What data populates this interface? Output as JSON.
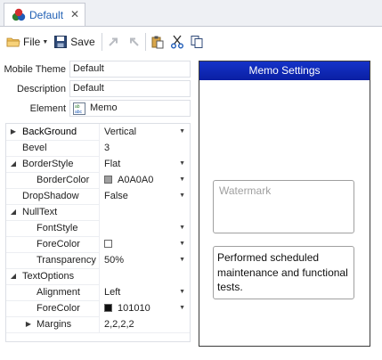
{
  "tab": {
    "label": "Default",
    "close_glyph": "✕",
    "icon": "theme-icon"
  },
  "toolbar": {
    "file_label": "File",
    "save_label": "Save",
    "icons": [
      "file-icon",
      "save-icon",
      "redo-icon",
      "undo-icon",
      "paste-icon",
      "cut-icon",
      "copy-icon"
    ]
  },
  "fields": [
    {
      "label": "Mobile Theme",
      "value": "Default"
    },
    {
      "label": "Description",
      "value": "Default"
    },
    {
      "label": "Element",
      "value": "Memo",
      "icon_text": "ab abc"
    }
  ],
  "properties": [
    {
      "name": "BackGround",
      "value": "Vertical",
      "expander": "▶",
      "dropdown": true,
      "selected": true
    },
    {
      "name": "Bevel",
      "value": "3"
    },
    {
      "name": "BorderStyle",
      "value": "Flat",
      "expander": "◢",
      "dropdown": true
    },
    {
      "name": "BorderColor",
      "value": "A0A0A0",
      "swatch": "#a0a0a0",
      "dropdown": true
    },
    {
      "name": "DropShadow",
      "value": "False",
      "dropdown": true
    },
    {
      "name": "NullText",
      "value": "",
      "expander": "◢"
    },
    {
      "name": "FontStyle",
      "value": "",
      "dropdown": true
    },
    {
      "name": "ForeColor",
      "value": "",
      "swatch": "#ffffff",
      "dropdown": true
    },
    {
      "name": "Transparency",
      "value": "50%",
      "dropdown": true
    },
    {
      "name": "TextOptions",
      "value": "",
      "expander": "◢"
    },
    {
      "name": "Alignment",
      "value": "Left",
      "dropdown": true
    },
    {
      "name": "ForeColor",
      "value": "101010",
      "swatch": "#101010",
      "dropdown": true
    },
    {
      "name": "Margins",
      "value": "2,2,2,2",
      "expander": "▶"
    }
  ],
  "preview": {
    "title": "Memo Settings",
    "watermark": "Watermark",
    "memo_text": "Performed scheduled maintenance and functional tests."
  },
  "colors": {
    "title_bar": "#1533c9",
    "tab_text": "#1f5fb4",
    "border_color": "#a0a0a0",
    "fore_color": "#101010"
  }
}
